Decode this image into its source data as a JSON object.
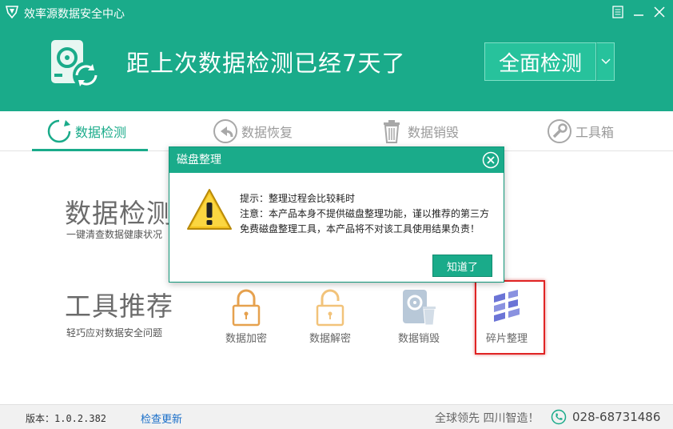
{
  "window": {
    "title": "效率源数据安全中心",
    "icons": [
      "shield-logo-icon",
      "menu-icon",
      "minimize-icon",
      "close-icon"
    ]
  },
  "header": {
    "message": "距上次数据检测已经7天了",
    "scan_button": "全面检测"
  },
  "tabs": [
    {
      "label": "数据检测",
      "icon": "refresh-icon",
      "active": true
    },
    {
      "label": "数据恢复",
      "icon": "back-arrow-icon",
      "active": false
    },
    {
      "label": "数据销毁",
      "icon": "trash-icon",
      "active": false
    },
    {
      "label": "工具箱",
      "icon": "wrench-icon",
      "active": false
    }
  ],
  "main": {
    "detect": {
      "title": "数据检测",
      "subtitle": "一键清查数据健康状况"
    },
    "tools": {
      "title": "工具推荐",
      "subtitle": "轻巧应对数据安全问题"
    },
    "tool_items": [
      {
        "label": "数据加密",
        "icon": "lock-icon"
      },
      {
        "label": "数据解密",
        "icon": "unlock-icon"
      },
      {
        "label": "数据销毁",
        "icon": "disk-trash-icon"
      },
      {
        "label": "碎片整理",
        "icon": "defrag-icon"
      }
    ]
  },
  "footer": {
    "version": "版本：1.0.2.382",
    "update": "检查更新",
    "slogan": "全球领先 四川智造！",
    "phone": "028-68731486"
  },
  "dialog": {
    "title": "磁盘整理",
    "line1": "提示：整理过程会比较耗时",
    "line2": "注意：本产品本身不提供磁盘整理功能，谨以推荐的第三方免费磁盘整理工具，本产品将不对该工具使用结果负责！",
    "ok": "知道了"
  },
  "colors": {
    "brand": "#1aab8a",
    "highlight": "#e02424",
    "defrag": "#6b74d6"
  }
}
